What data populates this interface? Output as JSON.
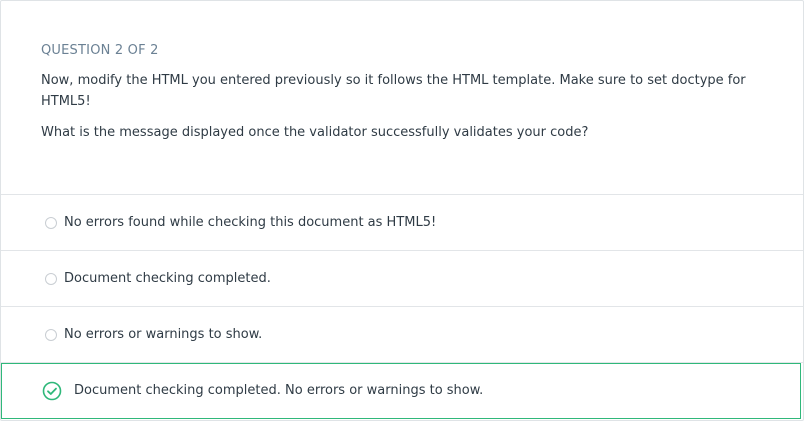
{
  "question": {
    "label": "QUESTION 2 OF 2",
    "text": "Now, modify the HTML you entered previously so it follows the HTML template. Make sure to set doctype for HTML5!",
    "prompt": "What is the message displayed once the validator successfully validates your code?"
  },
  "options": [
    {
      "label": "No errors found while checking this document as HTML5!",
      "state": "unselected"
    },
    {
      "label": "Document checking completed.",
      "state": "unselected"
    },
    {
      "label": "No errors or warnings to show.",
      "state": "unselected"
    },
    {
      "label": "Document checking completed. No errors or warnings to show.",
      "state": "correct"
    }
  ],
  "colors": {
    "correct_accent": "#2fb87a",
    "label_color": "#6b8194",
    "text_color": "#2f3b45",
    "divider": "#e2e5e8"
  },
  "icons": {
    "correct": "check-circle-icon",
    "unselected": "radio-empty-icon"
  }
}
